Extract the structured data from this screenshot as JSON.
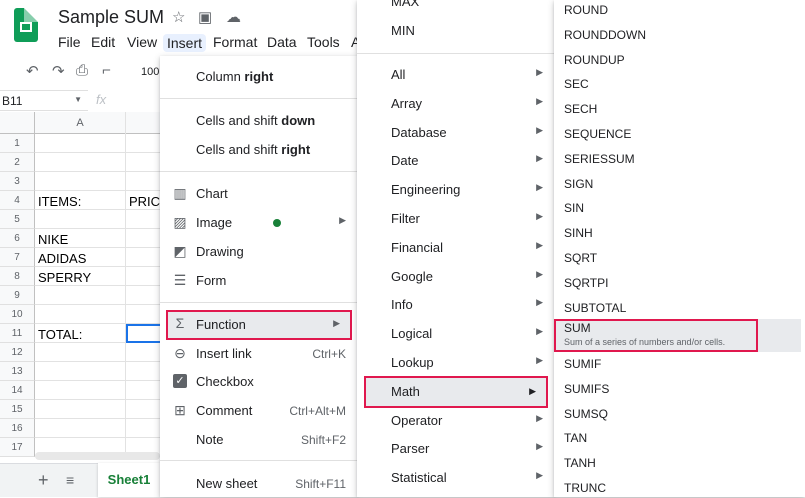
{
  "window": {
    "title": "Sample SUM"
  },
  "menubar": [
    "File",
    "Edit",
    "View",
    "Insert",
    "Format",
    "Data",
    "Tools",
    "A"
  ],
  "toolbar": {
    "zoom": "100"
  },
  "namebox": "B11",
  "fx": "fx",
  "grid": {
    "col_a": "A",
    "rows": [
      "1",
      "2",
      "3",
      "4",
      "5",
      "6",
      "7",
      "8",
      "9",
      "10",
      "11",
      "12",
      "13",
      "14",
      "15",
      "16",
      "17"
    ],
    "cells": {
      "r4a": "ITEMS:",
      "r4b": "PRICE",
      "r6a": "NIKE",
      "r7a": "ADIDAS",
      "r8a": "SPERRY",
      "r11a": "TOTAL:"
    }
  },
  "sheet_tab": "Sheet1",
  "insert_menu": {
    "column_right": [
      "Column ",
      "right"
    ],
    "cells_shift_down": [
      "Cells and shift ",
      "down"
    ],
    "cells_shift_right": [
      "Cells and shift ",
      "right"
    ],
    "chart": "Chart",
    "image": "Image",
    "drawing": "Drawing",
    "form": "Form",
    "function": "Function",
    "insert_link": "Insert link",
    "insert_link_sc": "Ctrl+K",
    "checkbox": "Checkbox",
    "comment": "Comment",
    "comment_sc": "Ctrl+Alt+M",
    "note": "Note",
    "note_sc": "Shift+F2",
    "new_sheet": "New sheet",
    "new_sheet_sc": "Shift+F11"
  },
  "function_menu": {
    "top": [
      "MAX",
      "MIN"
    ],
    "categories": [
      "All",
      "Array",
      "Database",
      "Date",
      "Engineering",
      "Filter",
      "Financial",
      "Google",
      "Info",
      "Logical",
      "Lookup",
      "Math",
      "Operator",
      "Parser",
      "Statistical"
    ]
  },
  "math_menu": {
    "items": [
      "ROUND",
      "ROUNDDOWN",
      "ROUNDUP",
      "SEC",
      "SECH",
      "SEQUENCE",
      "SERIESSUM",
      "SIGN",
      "SIN",
      "SINH",
      "SQRT",
      "SQRTPI",
      "SUBTOTAL"
    ],
    "sum": "SUM",
    "sum_desc": "Sum of a series of numbers and/or cells.",
    "after": [
      "SUMIF",
      "SUMIFS",
      "SUMSQ",
      "TAN",
      "TANH",
      "TRUNC"
    ]
  },
  "colors": {
    "highlight": "#e0184e",
    "green": "#188038",
    "accent": "#1a73e8"
  }
}
